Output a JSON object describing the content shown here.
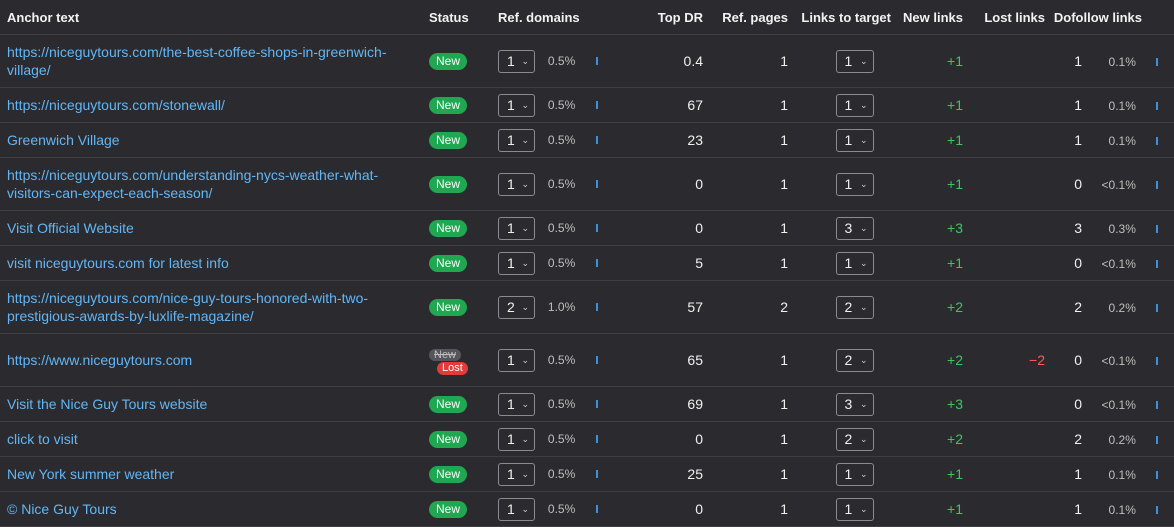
{
  "headers": {
    "anchor_text": "Anchor text",
    "status": "Status",
    "ref_domains": "Ref. domains",
    "top_dr": "Top DR",
    "ref_pages": "Ref. pages",
    "links_to_target": "Links to target",
    "new_links": "New links",
    "lost_links": "Lost links",
    "dofollow_links": "Dofollow links"
  },
  "status_labels": {
    "new": "New",
    "lost": "Lost"
  },
  "colors": {
    "link": "#62b6f5",
    "new_badge": "#1fa751",
    "lost_badge": "#e03c3c",
    "positive": "#3ec463",
    "negative": "#ff5a5a",
    "bar": "#3d8fe0"
  },
  "rows": [
    {
      "anchor": "https://niceguytours.com/the-best-coffee-shops-in-greenwich-village/",
      "status": "new",
      "ref_domains": "1",
      "ref_domains_pct": "0.5%",
      "top_dr": "0.4",
      "ref_pages": "1",
      "links_to_target": "1",
      "new_links": "+1",
      "lost_links": "",
      "dofollow": "1",
      "dofollow_pct": "0.1%"
    },
    {
      "anchor": "https://niceguytours.com/stonewall/",
      "status": "new",
      "ref_domains": "1",
      "ref_domains_pct": "0.5%",
      "top_dr": "67",
      "ref_pages": "1",
      "links_to_target": "1",
      "new_links": "+1",
      "lost_links": "",
      "dofollow": "1",
      "dofollow_pct": "0.1%"
    },
    {
      "anchor": "Greenwich Village",
      "status": "new",
      "ref_domains": "1",
      "ref_domains_pct": "0.5%",
      "top_dr": "23",
      "ref_pages": "1",
      "links_to_target": "1",
      "new_links": "+1",
      "lost_links": "",
      "dofollow": "1",
      "dofollow_pct": "0.1%"
    },
    {
      "anchor": "https://niceguytours.com/understanding-nycs-weather-what-visitors-can-expect-each-season/",
      "status": "new",
      "ref_domains": "1",
      "ref_domains_pct": "0.5%",
      "top_dr": "0",
      "ref_pages": "1",
      "links_to_target": "1",
      "new_links": "+1",
      "lost_links": "",
      "dofollow": "0",
      "dofollow_pct": "<0.1%"
    },
    {
      "anchor": "Visit Official Website",
      "status": "new",
      "ref_domains": "1",
      "ref_domains_pct": "0.5%",
      "top_dr": "0",
      "ref_pages": "1",
      "links_to_target": "3",
      "new_links": "+3",
      "lost_links": "",
      "dofollow": "3",
      "dofollow_pct": "0.3%"
    },
    {
      "anchor": "visit niceguytours.com for latest info",
      "status": "new",
      "ref_domains": "1",
      "ref_domains_pct": "0.5%",
      "top_dr": "5",
      "ref_pages": "1",
      "links_to_target": "1",
      "new_links": "+1",
      "lost_links": "",
      "dofollow": "0",
      "dofollow_pct": "<0.1%"
    },
    {
      "anchor": "https://niceguytours.com/nice-guy-tours-honored-with-two-prestigious-awards-by-luxlife-magazine/",
      "status": "new",
      "ref_domains": "2",
      "ref_domains_pct": "1.0%",
      "top_dr": "57",
      "ref_pages": "2",
      "links_to_target": "2",
      "new_links": "+2",
      "lost_links": "",
      "dofollow": "2",
      "dofollow_pct": "0.2%"
    },
    {
      "anchor": "https://www.niceguytours.com",
      "status": "lost",
      "ref_domains": "1",
      "ref_domains_pct": "0.5%",
      "top_dr": "65",
      "ref_pages": "1",
      "links_to_target": "2",
      "new_links": "+2",
      "lost_links": "−2",
      "dofollow": "0",
      "dofollow_pct": "<0.1%"
    },
    {
      "anchor": "Visit the Nice Guy Tours website",
      "status": "new",
      "ref_domains": "1",
      "ref_domains_pct": "0.5%",
      "top_dr": "69",
      "ref_pages": "1",
      "links_to_target": "3",
      "new_links": "+3",
      "lost_links": "",
      "dofollow": "0",
      "dofollow_pct": "<0.1%"
    },
    {
      "anchor": "click to visit",
      "status": "new",
      "ref_domains": "1",
      "ref_domains_pct": "0.5%",
      "top_dr": "0",
      "ref_pages": "1",
      "links_to_target": "2",
      "new_links": "+2",
      "lost_links": "",
      "dofollow": "2",
      "dofollow_pct": "0.2%"
    },
    {
      "anchor": "New York summer weather",
      "status": "new",
      "ref_domains": "1",
      "ref_domains_pct": "0.5%",
      "top_dr": "25",
      "ref_pages": "1",
      "links_to_target": "1",
      "new_links": "+1",
      "lost_links": "",
      "dofollow": "1",
      "dofollow_pct": "0.1%"
    },
    {
      "anchor": "© Nice Guy Tours",
      "status": "new",
      "ref_domains": "1",
      "ref_domains_pct": "0.5%",
      "top_dr": "0",
      "ref_pages": "1",
      "links_to_target": "1",
      "new_links": "+1",
      "lost_links": "",
      "dofollow": "1",
      "dofollow_pct": "0.1%"
    }
  ]
}
